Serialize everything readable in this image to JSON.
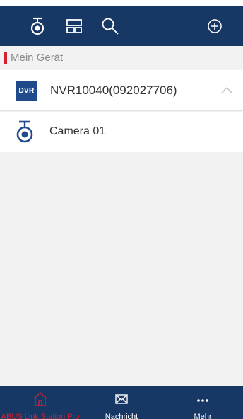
{
  "toolbar": {
    "icons": [
      "camera-icon",
      "layout-icon",
      "search-icon",
      "add-circle-icon"
    ]
  },
  "section": {
    "title": "Mein Gerät",
    "accent_color": "#d5212e"
  },
  "device": {
    "badge": "DVR",
    "name": "NVR10040(092027706)",
    "expanded": true
  },
  "cameras": [
    {
      "name": "Camera 01"
    }
  ],
  "bottom_nav": {
    "items": [
      {
        "label": "ABUS Link Station Pro",
        "icon": "home-icon",
        "active": true
      },
      {
        "label": "Nachricht",
        "icon": "mail-icon",
        "active": false
      },
      {
        "label": "Mehr",
        "icon": "more-icon",
        "active": false
      }
    ]
  },
  "colors": {
    "header_bg": "#173765",
    "badge_bg": "#1f4a8c",
    "active_red": "#d5212e"
  }
}
